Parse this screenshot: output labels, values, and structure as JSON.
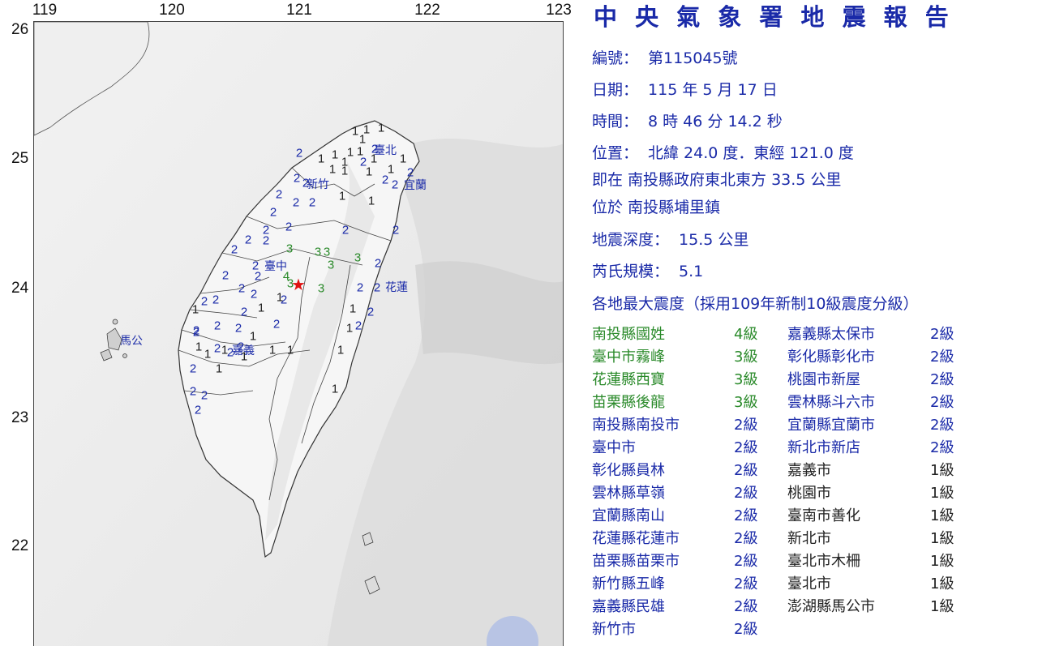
{
  "map": {
    "lon_labels": [
      "119",
      "120",
      "121",
      "122",
      "123"
    ],
    "lat_labels": [
      "26",
      "25",
      "24",
      "23",
      "22"
    ],
    "epicenter_symbol": "★",
    "city_labels": [
      "臺北",
      "宜蘭",
      "新竹",
      "臺中",
      "花蓮",
      "嘉義",
      "馬公"
    ],
    "intensity_marks": [
      "1",
      "1",
      "1",
      "1",
      "1",
      "1",
      "1",
      "2",
      "1",
      "1",
      "1",
      "1",
      "1",
      "2",
      "1",
      "1",
      "1",
      "2",
      "2",
      "2",
      "2",
      "2",
      "1",
      "2",
      "2",
      "2",
      "1",
      "2",
      "2",
      "2",
      "2",
      "2",
      "2",
      "2",
      "3",
      "2",
      "2",
      "3",
      "3",
      "3",
      "3",
      "2",
      "2",
      "2",
      "4",
      "3",
      "2",
      "3",
      "2",
      "2",
      "2",
      "2",
      "2",
      "2",
      "1",
      "2",
      "1",
      "2",
      "1",
      "2",
      "2",
      "2",
      "1",
      "2",
      "1",
      "2",
      "1",
      "2",
      "1",
      "2",
      "2",
      "2",
      "1",
      "1",
      "1",
      "1",
      "1",
      "1",
      "2",
      "2",
      "1",
      "2",
      "2",
      "2",
      "1"
    ]
  },
  "report": {
    "title": "中 央 氣 象 署 地 震 報 告",
    "number_label": "編號：",
    "number_value": "第115045號",
    "date_label": "日期：",
    "date_value": "115 年 5 月 17 日",
    "time_label": "時間：",
    "time_value": "8 時 46 分 14.2 秒",
    "location_label": "位置：",
    "location_value": "北緯 24.0 度．東經 121.0 度",
    "relative_line": "即在 南投縣政府東北東方 33.5 公里",
    "located_line": "位於 南投縣埔里鎮",
    "depth_label": "地震深度：",
    "depth_value": "15.5 公里",
    "magnitude_label": "芮氏規模：",
    "magnitude_value": "5.1",
    "intensity_heading": "各地最大震度（採用109年新制10級震度分級）",
    "left_column": [
      {
        "loc": "南投縣國姓",
        "lvl": "4級"
      },
      {
        "loc": "臺中市霧峰",
        "lvl": "3級"
      },
      {
        "loc": "花蓮縣西寶",
        "lvl": "3級"
      },
      {
        "loc": "苗栗縣後龍",
        "lvl": "3級"
      },
      {
        "loc": "南投縣南投市",
        "lvl": "2級"
      },
      {
        "loc": "臺中市",
        "lvl": "2級"
      },
      {
        "loc": "彰化縣員林",
        "lvl": "2級"
      },
      {
        "loc": "雲林縣草嶺",
        "lvl": "2級"
      },
      {
        "loc": "宜蘭縣南山",
        "lvl": "2級"
      },
      {
        "loc": "花蓮縣花蓮市",
        "lvl": "2級"
      },
      {
        "loc": "苗栗縣苗栗市",
        "lvl": "2級"
      },
      {
        "loc": "新竹縣五峰",
        "lvl": "2級"
      },
      {
        "loc": "嘉義縣民雄",
        "lvl": "2級"
      },
      {
        "loc": "新竹市",
        "lvl": "2級"
      }
    ],
    "right_column": [
      {
        "loc": "嘉義縣太保市",
        "lvl": "2級"
      },
      {
        "loc": "彰化縣彰化市",
        "lvl": "2級"
      },
      {
        "loc": "桃園市新屋",
        "lvl": "2級"
      },
      {
        "loc": "雲林縣斗六市",
        "lvl": "2級"
      },
      {
        "loc": "宜蘭縣宜蘭市",
        "lvl": "2級"
      },
      {
        "loc": "新北市新店",
        "lvl": "2級"
      },
      {
        "loc": "嘉義市",
        "lvl": "1級"
      },
      {
        "loc": "桃園市",
        "lvl": "1級"
      },
      {
        "loc": "臺南市善化",
        "lvl": "1級"
      },
      {
        "loc": "新北市",
        "lvl": "1級"
      },
      {
        "loc": "臺北市木柵",
        "lvl": "1級"
      },
      {
        "loc": "臺北市",
        "lvl": "1級"
      },
      {
        "loc": "澎湖縣馬公市",
        "lvl": "1級"
      }
    ],
    "colors": {
      "title_blue": "#1a2aa8",
      "level_green": "#2a8a2a",
      "level_black": "#222222",
      "epicenter_red": "#e01010"
    }
  }
}
